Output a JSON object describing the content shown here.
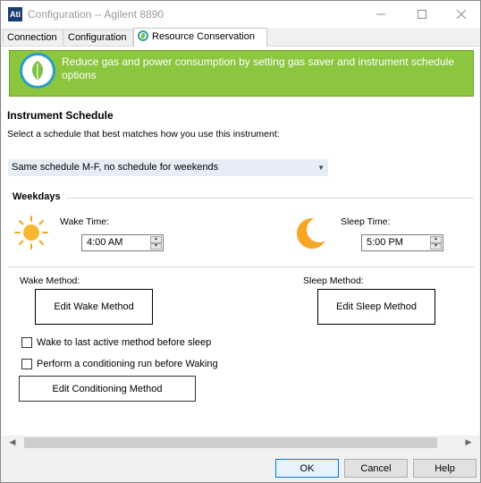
{
  "window": {
    "icon_text": "Ati",
    "title": "Configuration -- Agilent 8890"
  },
  "tabs": [
    {
      "label": "Connection"
    },
    {
      "label": "Configuration"
    },
    {
      "label": "Resource Conservation"
    }
  ],
  "banner": {
    "text": "Reduce gas and power consumption by setting gas saver and instrument schedule options",
    "color": "#8cc63f"
  },
  "schedule": {
    "heading": "Instrument Schedule",
    "instruction": "Select a schedule that best matches how you use this instrument:",
    "selected": "Same schedule M-F, no schedule for weekends"
  },
  "weekdays": {
    "heading": "Weekdays",
    "wake_label": "Wake Time:",
    "wake_value": "4:00 AM",
    "sleep_label": "Sleep Time:",
    "sleep_value": "5:00 PM"
  },
  "methods": {
    "wake_label": "Wake Method:",
    "wake_button": "Edit Wake Method",
    "sleep_label": "Sleep Method:",
    "sleep_button": "Edit Sleep Method",
    "checkbox_last_active": "Wake to last active method before sleep",
    "checkbox_conditioning": "Perform a conditioning run before Waking",
    "conditioning_button": "Edit Conditioning Method"
  },
  "footer": {
    "ok": "OK",
    "cancel": "Cancel",
    "help": "Help"
  }
}
